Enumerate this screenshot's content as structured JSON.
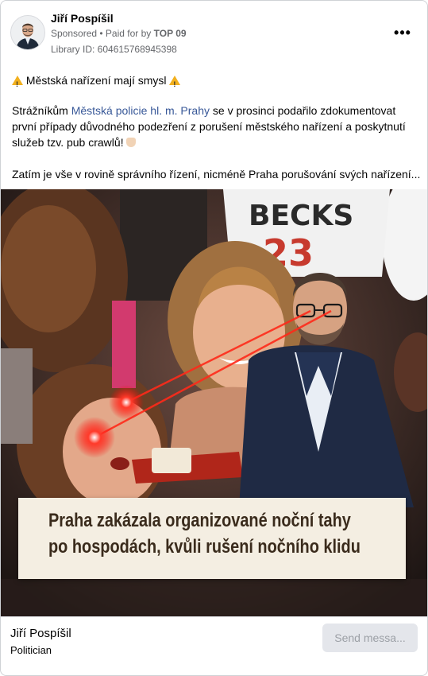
{
  "post": {
    "author": "Jiří Pospíšil",
    "sponsored": "Sponsored",
    "paid_for_prefix": "• Paid for by",
    "paid_by": "TOP 09",
    "library_id": "Library ID: 604615768945398",
    "more_label": "•••"
  },
  "body": {
    "title": "Městská nařízení mají smysl",
    "p2_start": "Strážníkům ",
    "p2_link": "Městská policie hl. m. Prahy",
    "p2_rest": " se v prosinci podařilo zdokumentovat první případy důvodného podezření z porušení městského nařízení a poskytnutí služeb tzv. pub crawlů!",
    "p3": "Zatím je vše v rovině správního řízení, nicméně Praha porušování svých nařízení..."
  },
  "image": {
    "shirt_text": "BECKS",
    "shirt_number": "23",
    "caption_line1": "Praha zakázala organizované noční tahy",
    "caption_line2": "po hospodách, kvůli rušení nočního klidu"
  },
  "footer": {
    "name": "Jiří Pospíšil",
    "category": "Politician",
    "send_label": "Send messa..."
  }
}
